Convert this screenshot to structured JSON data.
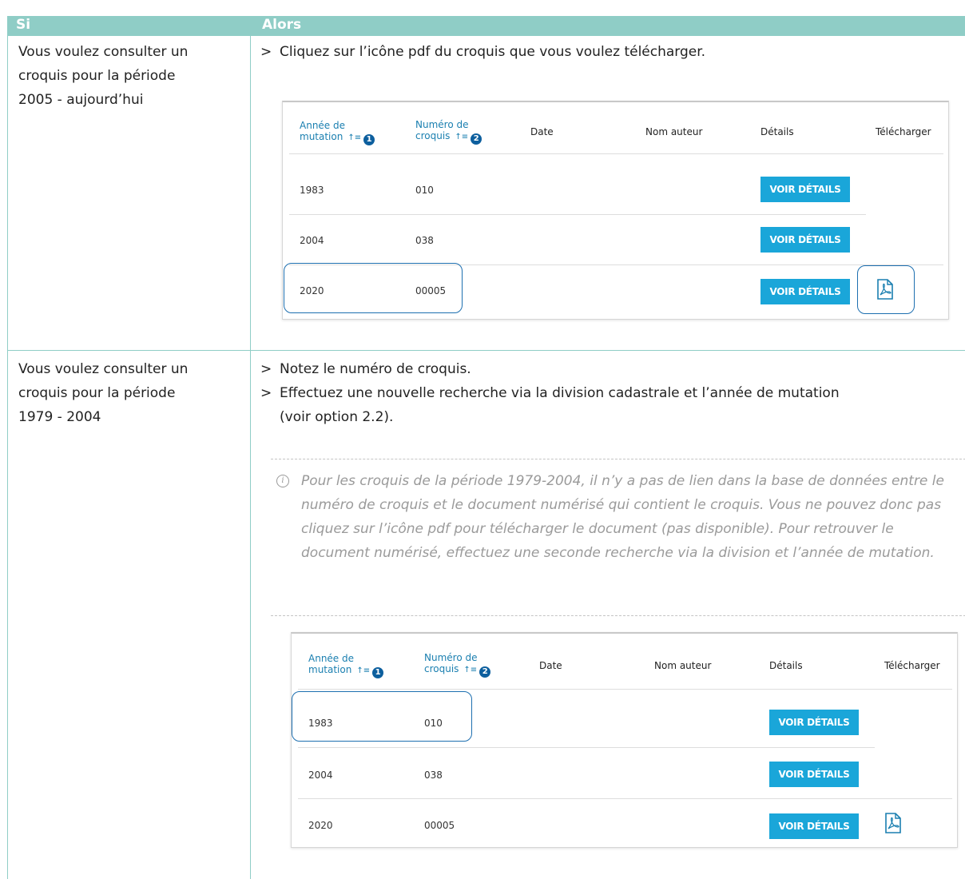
{
  "header": {
    "si": "Si",
    "alors": "Alors"
  },
  "row1": {
    "left": [
      "Vous voulez consulter un",
      "croquis pour la période",
      "2005 - aujourd’hui"
    ],
    "bullet": ">",
    "text": "Cliquez sur l’icône pdf du croquis que vous voulez télécharger."
  },
  "row2": {
    "left": [
      "Vous voulez consulter un",
      "croquis pour la période",
      "1979 - 2004"
    ],
    "bullet1": "Notez le numéro de croquis.",
    "bullet2": "Effectuez une nouvelle recherche via la division cadastrale et l’année de mutation",
    "bullet2_cont": "(voir option 2.2).",
    "note_icon": "i",
    "note": "Pour les croquis de la période 1979-2004, il n’y a pas de lien dans la base de données entre le numéro de croquis et le document numérisé qui contient le croquis. Vous ne pouvez donc pas cliquez sur l’icône pdf pour télécharger le document (pas disponible). Pour retrouver le document numérisé, effectuez une seconde recherche via la division et l’année de mutation."
  },
  "table": {
    "col1": [
      "Année de",
      "mutation"
    ],
    "col2": [
      "Numéro de",
      "croquis"
    ],
    "badge1": "1",
    "badge2": "2",
    "sort_icon": "sort-ascending-icon",
    "col3": "Date",
    "col4": "Nom auteur",
    "col5": "Détails",
    "col6": "Télécharger",
    "button": "VOIR DÉTAILS",
    "rows": [
      {
        "annee": "1983",
        "numero": "010"
      },
      {
        "annee": "2004",
        "numero": "038"
      },
      {
        "annee": "2020",
        "numero": "00005"
      }
    ]
  },
  "colors": {
    "header": "#8fcdc6",
    "button": "#1aa6d9",
    "highlight": "#1d6fb0"
  }
}
